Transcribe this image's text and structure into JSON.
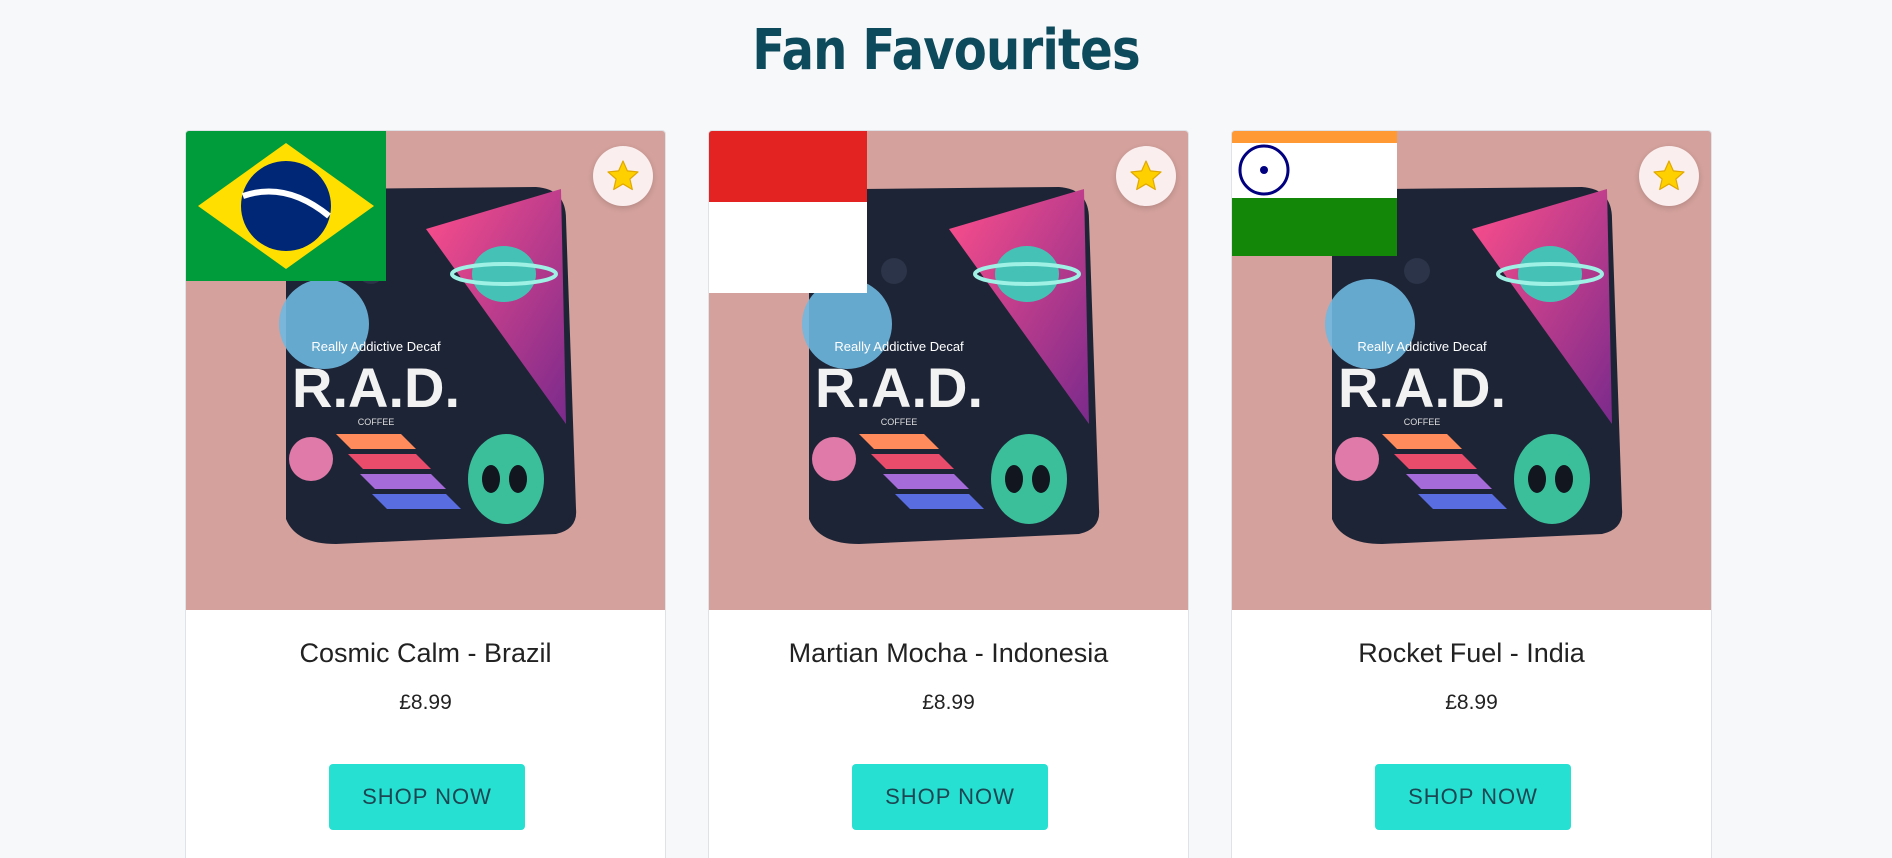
{
  "section": {
    "title": "Fan Favourites"
  },
  "products": [
    {
      "name": "Cosmic Calm - Brazil",
      "price": "£8.99",
      "button_label": "SHOP NOW",
      "flag": "brazil-flag"
    },
    {
      "name": "Martian Mocha - Indonesia",
      "price": "£8.99",
      "button_label": "SHOP NOW",
      "flag": "indonesia-flag"
    },
    {
      "name": "Rocket Fuel - India",
      "price": "£8.99",
      "button_label": "SHOP NOW",
      "flag": "india-flag"
    }
  ],
  "bag": {
    "tagline": "Really Addictive Decaf",
    "brand": "R.A.D.",
    "sub": "COFFEE"
  },
  "icons": {
    "favourite": "star-icon"
  },
  "colors": {
    "title": "#0d4a5c",
    "card_media_bg": "#d4a19c",
    "button_bg": "#26e0d2",
    "button_text": "#1d4652",
    "star": "#ffd000"
  }
}
